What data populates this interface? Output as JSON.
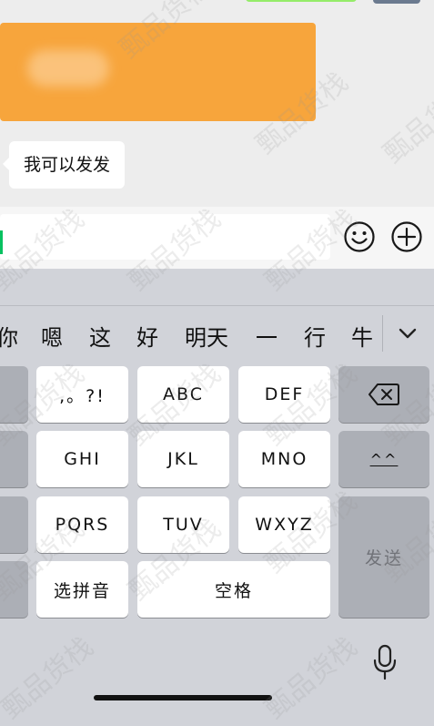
{
  "chat": {
    "received_message": "我可以发发"
  },
  "candidates": [
    "你",
    "嗯",
    "这",
    "好",
    "明天",
    "一",
    "行",
    "牛"
  ],
  "keys": {
    "punct": ",。?!",
    "abc": "ABC",
    "def": "DEF",
    "ghi": "GHI",
    "jkl": "JKL",
    "mno": "MNO",
    "pqrs": "PQRS",
    "tuv": "TUV",
    "wxyz": "WXYZ",
    "emoticon": "^^",
    "select_pinyin": "选拼音",
    "space": "空格",
    "send": "发送"
  },
  "colors": {
    "cursor": "#07c160",
    "redacted_block": "#f7a53c",
    "sent_bubble": "#95ec69"
  },
  "watermark": "甄品货栈",
  "icons": [
    "emoji-icon",
    "plus-icon",
    "chevron-down-icon",
    "backspace-icon",
    "microphone-icon"
  ]
}
